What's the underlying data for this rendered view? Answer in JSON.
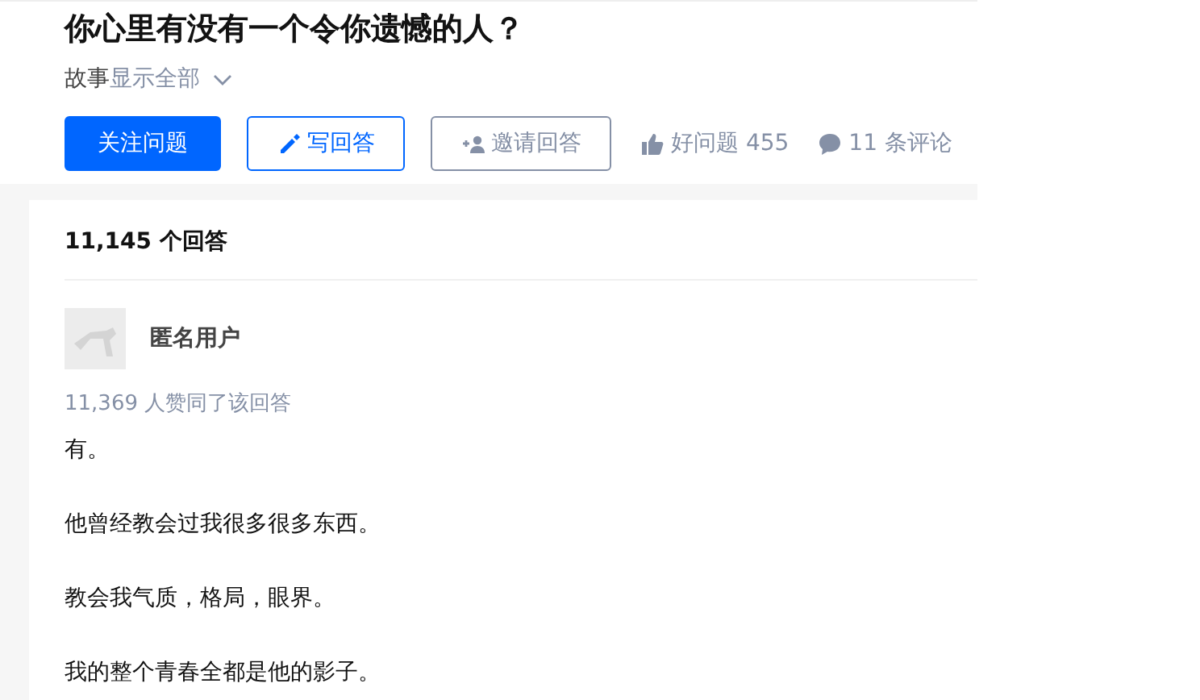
{
  "question": {
    "title": "你心里有没有一个令你遗憾的人？",
    "topic": "故事",
    "expand_link": "显示全部",
    "actions": [
      {
        "kind": "primary",
        "label": "关注问题"
      },
      {
        "kind": "outline",
        "label": "写回答"
      },
      {
        "kind": "plain",
        "label": "邀请回答"
      }
    ],
    "good_question": "好问题 455",
    "comments": "11 条评论"
  },
  "answers": {
    "count": "11,145 个回答",
    "author": "匿名用户",
    "votes": "11,369 人赞同了该回答",
    "paragraphs": [
      "有。",
      "他曾经教会过我很多很多东西。",
      "教会我气质，格局，眼界。",
      "我的整个青春全都是他的影子。"
    ]
  }
}
